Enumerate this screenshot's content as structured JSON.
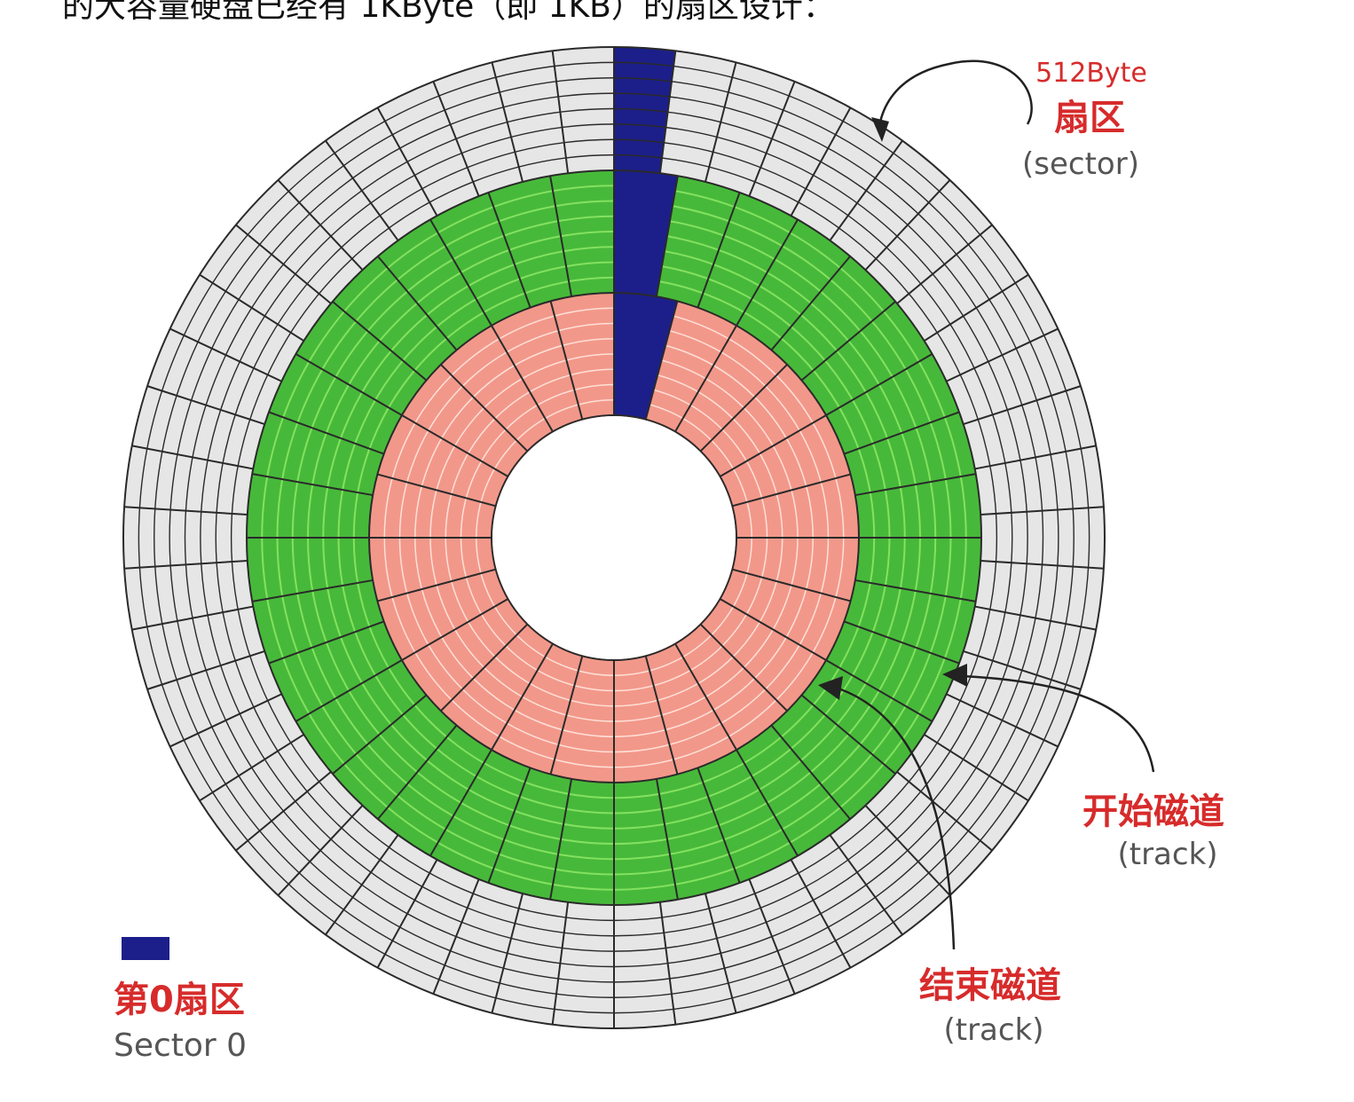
{
  "header": {
    "partial_text": "的大容量硬盘已经有 1KByte（即 1KB）的扇区设计："
  },
  "diagram": {
    "colors": {
      "outer_zone": "#e6e6e6",
      "middle_zone": "#47b93a",
      "middle_zone_light": "#84e160",
      "inner_zone": "#f2988a",
      "inner_zone_light": "#ffe0d8",
      "sector_zero": "#1c1f8a",
      "grid_line": "#2a2a2a",
      "label_red": "#d72b2b",
      "label_gray": "#555555"
    },
    "sector_label": {
      "size": "512Byte",
      "name": "扇区",
      "english": "(sector)"
    },
    "start_track_label": {
      "name": "开始磁道",
      "english": "(track)"
    },
    "end_track_label": {
      "name": "结束磁道",
      "english": "(track)"
    },
    "legend": {
      "name": "第0扇区",
      "english": "Sector 0",
      "swatch_color": "#1c1f8a"
    }
  }
}
